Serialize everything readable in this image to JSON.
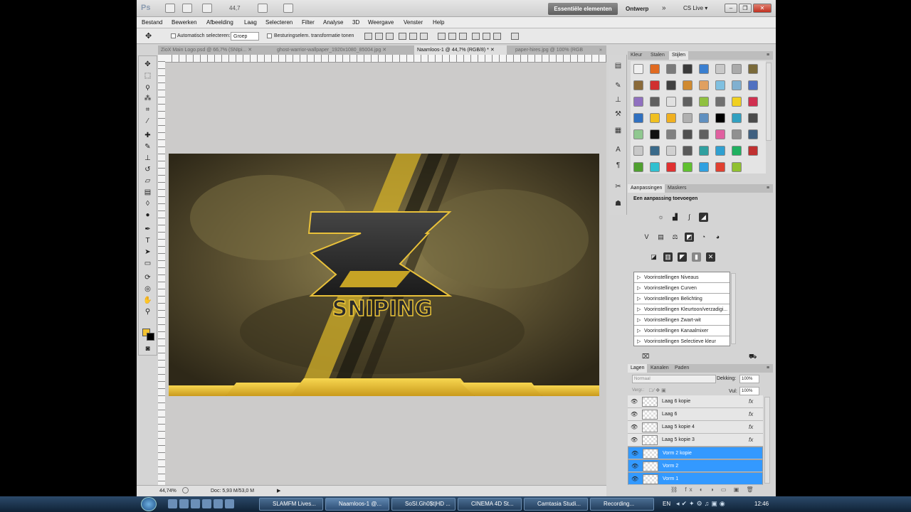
{
  "appbar": {
    "logo": "Ps",
    "zoom": "44,7",
    "workspace_active": "Essentiële elementen",
    "workspace_other": "Ontwerp",
    "more": "»",
    "cslive": "CS Live ▾",
    "min": "–",
    "max": "❐",
    "close": "✕"
  },
  "menu": [
    "Bestand",
    "Bewerken",
    "Afbeelding",
    "Laag",
    "Selecteren",
    "Filter",
    "Analyse",
    "3D",
    "Weergave",
    "Venster",
    "Help"
  ],
  "options": {
    "auto_select": "Automatisch selecteren:",
    "group": "Groep",
    "transform": "Besturingselem. transformatie tonen"
  },
  "tabs": [
    {
      "label": "ZioX Main Logo.psd @ 66,7% (SNIpi...",
      "close": "✕"
    },
    {
      "label": "ghost-warrior-wallpaper_1920x1080_85004.jpg",
      "close": "✕"
    },
    {
      "label": "Naamloos-1 @ 44,7% (RGB/8) *",
      "close": "✕"
    },
    {
      "label": "paper-hires.jpg @ 100% (RGB",
      "close": ""
    }
  ],
  "tabs_more": "»",
  "canvas": {
    "logo_text": "SNIPING"
  },
  "status": {
    "zoom": "44,74%",
    "doc": "Doc: 5,93 M/53,0 M"
  },
  "swatches_panel": {
    "tabs": [
      "Kleur",
      "Stalen",
      "Stijlen"
    ],
    "colors": [
      "#f0f0f0",
      "#e06a20",
      "#7a7a7a",
      "#3a3a3a",
      "#3a7fd0",
      "#c8c8c8",
      "#aaaaaa",
      "#7a6a3a",
      "#8a6a3a",
      "#d03030",
      "#404040",
      "#d08a30",
      "#e0a060",
      "#80c0e0",
      "#80b0d0",
      "#5070c0",
      "#9070c0",
      "#606060",
      "#e0e0e0",
      "#606060",
      "#90c040",
      "#707070",
      "#f0d020",
      "#d03050",
      "#3070c0",
      "#f0c020",
      "#f0b020",
      "#b0b0b0",
      "#6090c0",
      "#000000",
      "#30a0c0",
      "#4a4a4a",
      "#90c890",
      "#101010",
      "#808080",
      "#505050",
      "#606060",
      "#e060a0",
      "#909090",
      "#406080",
      "#c8c8c8",
      "#3a6a8a",
      "#d0d0d0",
      "#5a5a5a",
      "#30a0a0",
      "#30a0d0",
      "#20b060",
      "#c03030",
      "#50a030",
      "#30c0d0",
      "#e03030",
      "#60c030",
      "#30a0e0",
      "#e04030",
      "#90c030"
    ]
  },
  "adjustments_panel": {
    "tabs": [
      "Aanpassingen",
      "Maskers"
    ],
    "title": "Een aanpassing toevoegen",
    "presets": [
      "Voorinstellingen Niveaus",
      "Voorinstellingen Curven",
      "Voorinstellingen Belichting",
      "Voorinstellingen Kleurtoon/verzadigi...",
      "Voorinstellingen Zwart-wit",
      "Voorinstellingen Kanaalmixer",
      "Voorinstellingen Selectieve kleur"
    ]
  },
  "layers_panel": {
    "tabs": [
      "Lagen",
      "Kanalen",
      "Paden"
    ],
    "blend_mode": "Normaal",
    "opacity_label": "Dekking:",
    "opacity_value": "100%",
    "lock_label": "Vergr.:",
    "fill_label": "Vul:",
    "fill_value": "100%",
    "layers": [
      {
        "name": "Laag 6 kopie",
        "fx": "fx",
        "selected": false
      },
      {
        "name": "Laag 6",
        "fx": "fx",
        "selected": false
      },
      {
        "name": "Laag 5 kopie 4",
        "fx": "fx",
        "selected": false
      },
      {
        "name": "Laag 5 kopie 3",
        "fx": "fx",
        "selected": false
      },
      {
        "name": "Vorm 2 kopie",
        "fx": "",
        "selected": true
      },
      {
        "name": "Vorm 2",
        "fx": "",
        "selected": true
      },
      {
        "name": "Vorm 1",
        "fx": "",
        "selected": true
      }
    ]
  },
  "taskbar": {
    "tasks": [
      "SLAMFM Lives...",
      "Naamloos-1 @...",
      "SoSI.Gh0$t|HD ...",
      "CINEMA 4D St...",
      "Camtasia Studi...",
      "Recording..."
    ],
    "lang": "EN",
    "time": "12:46"
  }
}
